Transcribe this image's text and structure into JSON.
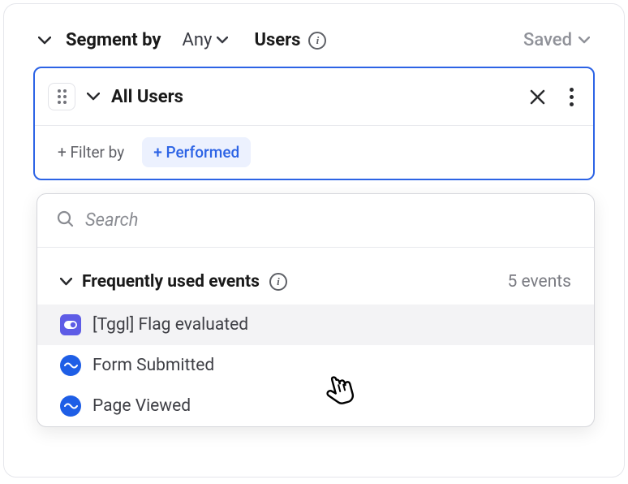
{
  "header": {
    "segment_label": "Segment by",
    "any_label": "Any",
    "users_label": "Users",
    "saved_label": "Saved"
  },
  "segment_box": {
    "title": "All Users",
    "filter_by_label": "+ Filter by",
    "performed_label": "+ Performed"
  },
  "dropdown": {
    "search_placeholder": "Search",
    "section_title": "Frequently used events",
    "events_count_label": "5 events",
    "events": [
      {
        "label": "[Tggl] Flag evaluated",
        "icon_type": "toggle",
        "icon_color": "purple"
      },
      {
        "label": "Form Submitted",
        "icon_type": "wave",
        "icon_color": "blue"
      },
      {
        "label": "Page Viewed",
        "icon_type": "wave",
        "icon_color": "blue"
      }
    ]
  }
}
